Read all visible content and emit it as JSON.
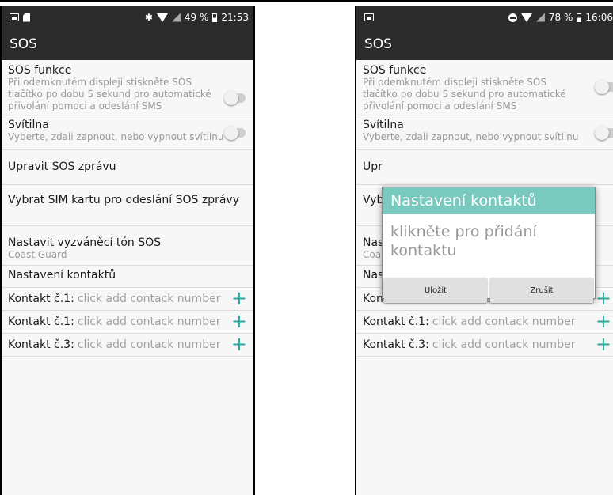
{
  "left": {
    "status": {
      "battery": "49 %",
      "time": "21:53"
    },
    "app_title": "SOS"
  },
  "right": {
    "status": {
      "battery": "78 %",
      "time": "16:06"
    },
    "app_title": "SOS"
  },
  "settings": {
    "sos": {
      "title": "SOS funkce",
      "sub1": "Při odemknutém displeji stiskněte SOS",
      "sub2": "tlačítko po dobu 5 sekund pro automatické",
      "sub3": "přivolání pomoci a odeslání SMS",
      "enabled": false
    },
    "torch": {
      "title": "Svítilna",
      "sub": "Vyberte, zdali zapnout, nebo vypnout svítilnu",
      "enabled": false
    },
    "edit_msg": {
      "title": "Upravit SOS zprávu"
    },
    "sim": {
      "title": "Vybrat SIM kartu pro odeslání SOS zprávy"
    },
    "ringtone": {
      "title": "Nastavit vyzváněcí tón SOS",
      "sub": "Coast Guard"
    },
    "contacts_header": {
      "title": "Nastavení kontaktů"
    }
  },
  "contacts": [
    {
      "label": "Kontakt č.1:",
      "hint": "click add contack number"
    },
    {
      "label": "Kontakt č.1:",
      "hint": "click add contack number"
    },
    {
      "label": "Kontakt č.3:",
      "hint": "click add contack number"
    }
  ],
  "partial": {
    "edit_msg": "Upr",
    "sim": "Vyb",
    "ringtone": "Nas",
    "ringtone_sub": "Coa",
    "contacts_header": "Nas"
  },
  "plus_glyph": "+",
  "dialog": {
    "title": "Nastavení kontaktů",
    "body_line1": "klikněte pro přidání",
    "body_line2": "kontaktu",
    "save": "Uložit",
    "cancel": "Zrušit"
  },
  "colors": {
    "accent": "#2aa79b",
    "dialog_header": "#79c9bf",
    "bar": "#2b2b2b"
  }
}
